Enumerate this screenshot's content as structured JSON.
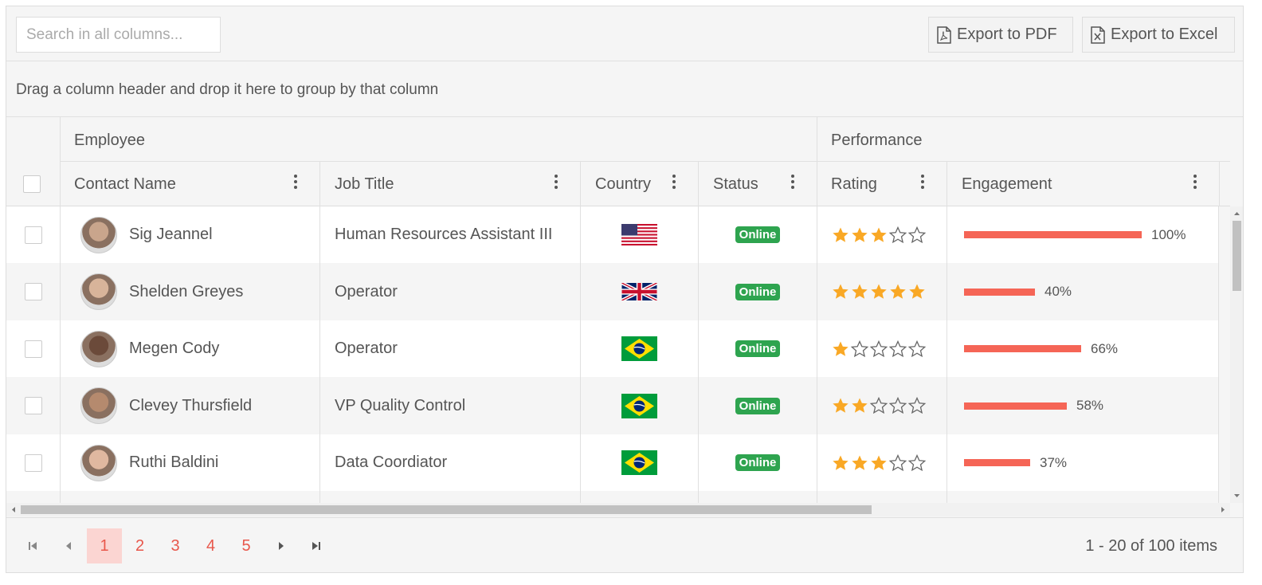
{
  "toolbar": {
    "search_placeholder": "Search in all columns...",
    "export_pdf": "Export to PDF",
    "export_excel": "Export to Excel"
  },
  "group_panel": {
    "hint": "Drag a column header and drop it here to group by that column"
  },
  "header": {
    "groups": {
      "employee": "Employee",
      "performance": "Performance"
    },
    "columns": {
      "contact_name": "Contact Name",
      "job_title": "Job Title",
      "country": "Country",
      "status": "Status",
      "rating": "Rating",
      "engagement": "Engagement"
    }
  },
  "rows": [
    {
      "name": "Sig Jeannel",
      "job": "Human Resources Assistant III",
      "country": "US",
      "status": "Online",
      "rating": 3,
      "engagement": 100,
      "engagement_label": "100%"
    },
    {
      "name": "Shelden Greyes",
      "job": "Operator",
      "country": "UK",
      "status": "Online",
      "rating": 5,
      "engagement": 40,
      "engagement_label": "40%"
    },
    {
      "name": "Megen Cody",
      "job": "Operator",
      "country": "BR",
      "status": "Online",
      "rating": 1,
      "engagement": 66,
      "engagement_label": "66%"
    },
    {
      "name": "Clevey Thursfield",
      "job": "VP Quality Control",
      "country": "BR",
      "status": "Online",
      "rating": 2,
      "engagement": 58,
      "engagement_label": "58%"
    },
    {
      "name": "Ruthi Baldini",
      "job": "Data Coordiator",
      "country": "BR",
      "status": "Online",
      "rating": 3,
      "engagement": 37,
      "engagement_label": "37%"
    }
  ],
  "pager": {
    "pages": [
      "1",
      "2",
      "3",
      "4",
      "5"
    ],
    "current": "1",
    "info": "1 - 20 of 100 items"
  },
  "colors": {
    "accent": "#e8574b",
    "bar": "#f56556",
    "star": "#f9a825",
    "status_online": "#2ea44f"
  },
  "icons": [
    "pdf-file-icon",
    "excel-file-icon",
    "kebab-menu-icon",
    "star-icon",
    "first-page-icon",
    "prev-page-icon",
    "next-page-icon",
    "last-page-icon"
  ]
}
